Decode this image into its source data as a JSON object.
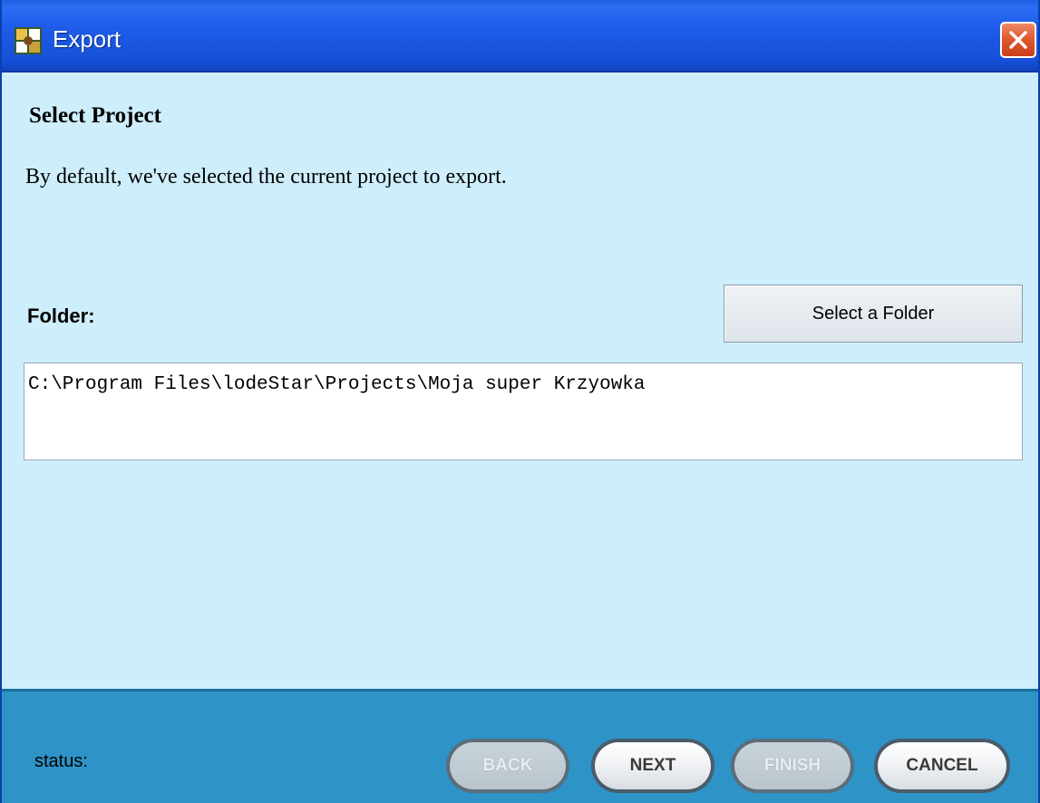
{
  "window": {
    "title": "Export"
  },
  "content": {
    "heading": "Select Project",
    "description": "By default, we've selected the current project to export.",
    "folder_label": "Folder:",
    "select_folder_button": "Select a Folder",
    "folder_path": "C:\\Program Files\\lodeStar\\Projects\\Moja super Krzyowka"
  },
  "footer": {
    "status_label": "status:",
    "buttons": {
      "back": "BACK",
      "next": "NEXT",
      "finish": "FINISH",
      "cancel": "CANCEL"
    }
  },
  "icons": {
    "app": "app-icon",
    "close": "close-icon"
  },
  "colors": {
    "titlebar": "#1e5ce8",
    "content_background": "#cfeefc",
    "footer_background": "#2e93c7",
    "close_button": "#e05a30"
  }
}
